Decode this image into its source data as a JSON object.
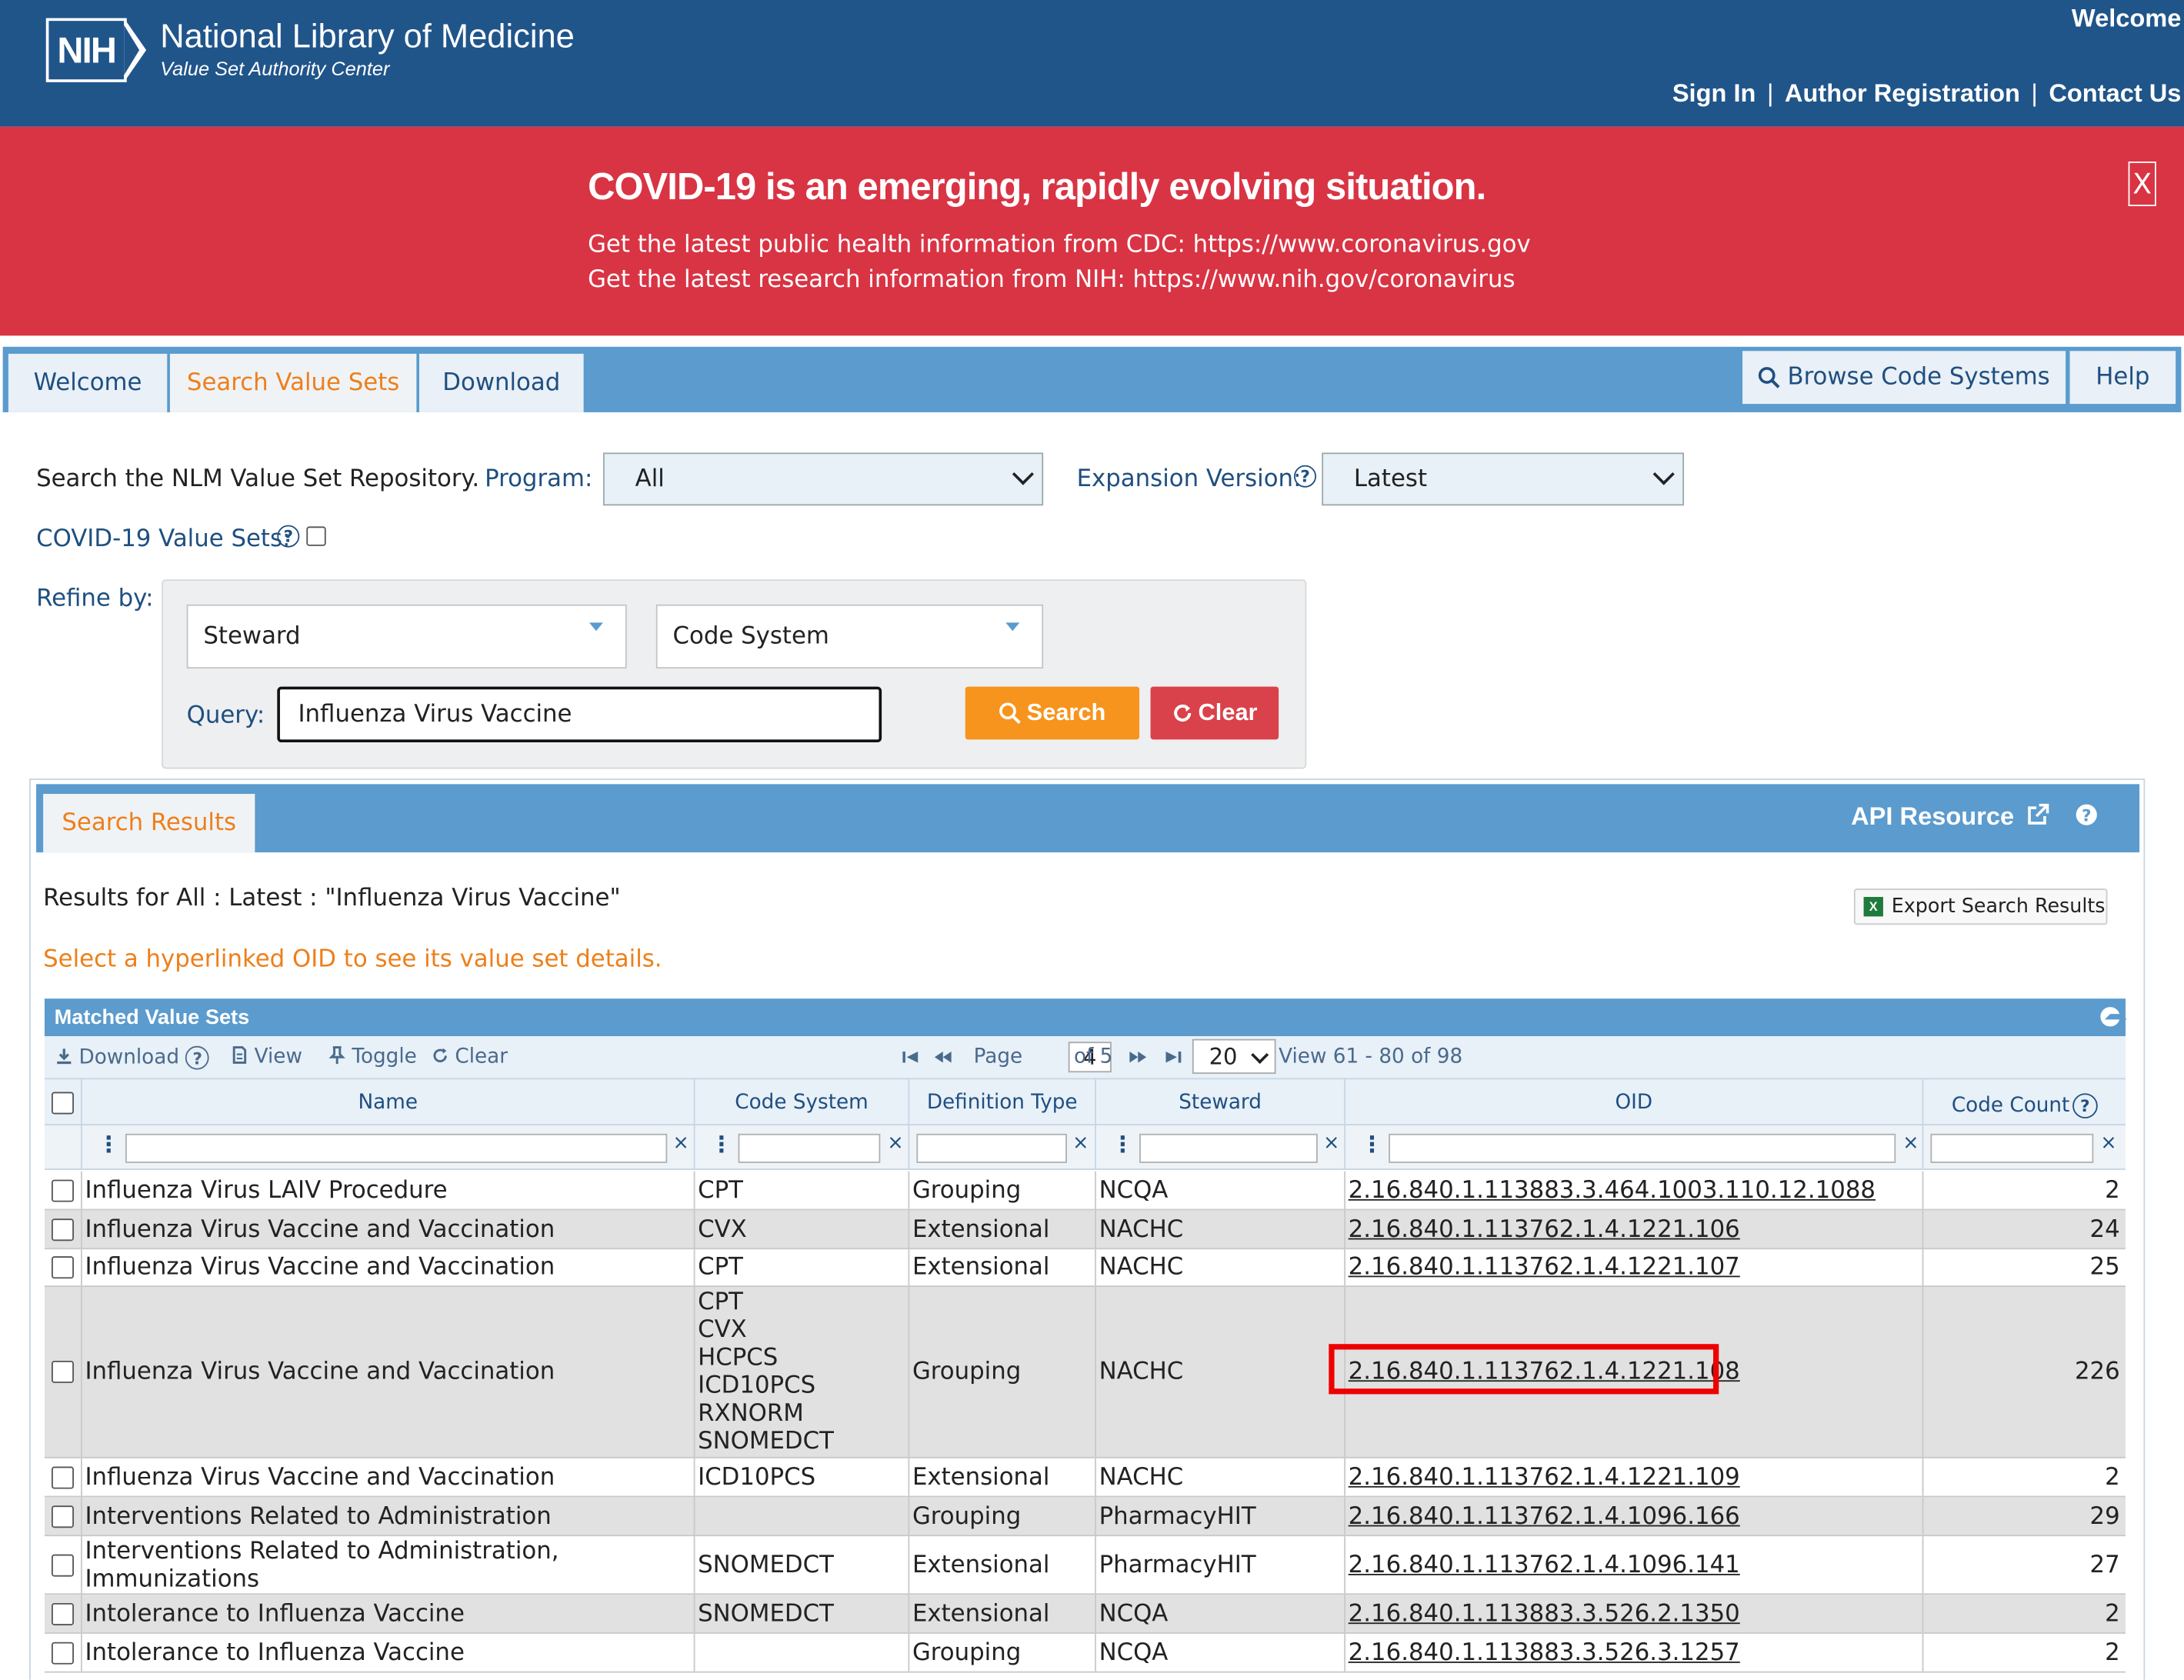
{
  "header": {
    "logo_text": "NIH",
    "org_name": "National Library of Medicine",
    "org_sub": "Value Set Authority Center",
    "welcome": "Welcome",
    "links": [
      "Sign In",
      "Author Registration",
      "Contact Us"
    ],
    "link_separator": "|"
  },
  "banner": {
    "title": "COVID-19 is an emerging, rapidly evolving situation.",
    "line1": "Get the latest public health information from CDC: https://www.coronavirus.gov",
    "line2": "Get the latest research information from NIH: https://www.nih.gov/coronavirus",
    "close": "X",
    "bg_color": "#d93444"
  },
  "nav": {
    "tabs": [
      "Welcome",
      "Search Value Sets",
      "Download"
    ],
    "active_tab": "Search Value Sets",
    "right": [
      "Browse Code Systems",
      "Help"
    ]
  },
  "search": {
    "intro": "Search the NLM Value Set Repository.",
    "program_label": "Program:",
    "program_value": "All",
    "expansion_label": "Expansion Version:",
    "expansion_value": "Latest",
    "covid_label": "COVID-19 Value Sets:",
    "refine_label": "Refine by:",
    "steward_placeholder": "Steward",
    "code_system_placeholder": "Code System",
    "query_label": "Query:",
    "query_value": "Influenza Virus Vaccine",
    "search_button": "Search",
    "clear_button": "Clear",
    "search_color": "#f7941d",
    "clear_color": "#d9424a"
  },
  "results": {
    "tab": "Search Results",
    "api": "API Resource",
    "summary": "Results for All : Latest : \"Influenza Virus Vaccine\"",
    "hint": "Select a hyperlinked OID to see its value set details.",
    "export": "Export Search Results"
  },
  "grid": {
    "title": "Matched Value Sets",
    "toolbar": {
      "download": "Download",
      "view": "View",
      "toggle": "Toggle",
      "clear": "Clear",
      "page_label": "Page",
      "page": "4",
      "of": "of 5",
      "page_size": "20",
      "view_range": "View 61 - 80 of 98"
    },
    "columns": [
      "Name",
      "Code System",
      "Definition Type",
      "Steward",
      "OID",
      "Code Count"
    ],
    "rows": [
      {
        "name": "Influenza Virus LAIV Procedure",
        "code_system": "CPT",
        "def_type": "Grouping",
        "steward": "NCQA",
        "oid": "2.16.840.1.113883.3.464.1003.110.12.1088",
        "count": "2"
      },
      {
        "name": "Influenza Virus Vaccine and Vaccination",
        "code_system": "CVX",
        "def_type": "Extensional",
        "steward": "NACHC",
        "oid": "2.16.840.1.113762.1.4.1221.106",
        "count": "24"
      },
      {
        "name": "Influenza Virus Vaccine and Vaccination",
        "code_system": "CPT",
        "def_type": "Extensional",
        "steward": "NACHC",
        "oid": "2.16.840.1.113762.1.4.1221.107",
        "count": "25"
      },
      {
        "name": "Influenza Virus Vaccine and Vaccination",
        "code_systems": [
          "CPT",
          "CVX",
          "HCPCS",
          "ICD10PCS",
          "RXNORM",
          "SNOMEDCT"
        ],
        "def_type": "Grouping",
        "steward": "NACHC",
        "oid": "2.16.840.1.113762.1.4.1221.108",
        "count": "226"
      },
      {
        "name": "Influenza Virus Vaccine and Vaccination",
        "code_system": "ICD10PCS",
        "def_type": "Extensional",
        "steward": "NACHC",
        "oid": "2.16.840.1.113762.1.4.1221.109",
        "count": "2"
      },
      {
        "name": "Interventions Related to Administration",
        "code_system": "",
        "def_type": "Grouping",
        "steward": "PharmacyHIT",
        "oid": "2.16.840.1.113762.1.4.1096.166",
        "count": "29"
      },
      {
        "name_lines": [
          "Interventions Related to Administration,",
          "Immunizations"
        ],
        "code_system": "SNOMEDCT",
        "def_type": "Extensional",
        "steward": "PharmacyHIT",
        "oid": "2.16.840.1.113762.1.4.1096.141",
        "count": "27"
      },
      {
        "name": "Intolerance to Influenza Vaccine",
        "code_system": "SNOMEDCT",
        "def_type": "Extensional",
        "steward": "NCQA",
        "oid": "2.16.840.1.113883.3.526.2.1350",
        "count": "2"
      },
      {
        "name": "Intolerance to Influenza Vaccine",
        "code_system": "",
        "def_type": "Grouping",
        "steward": "NCQA",
        "oid": "2.16.840.1.113883.3.526.3.1257",
        "count": "2"
      }
    ],
    "highlight_color": "#e00000"
  }
}
